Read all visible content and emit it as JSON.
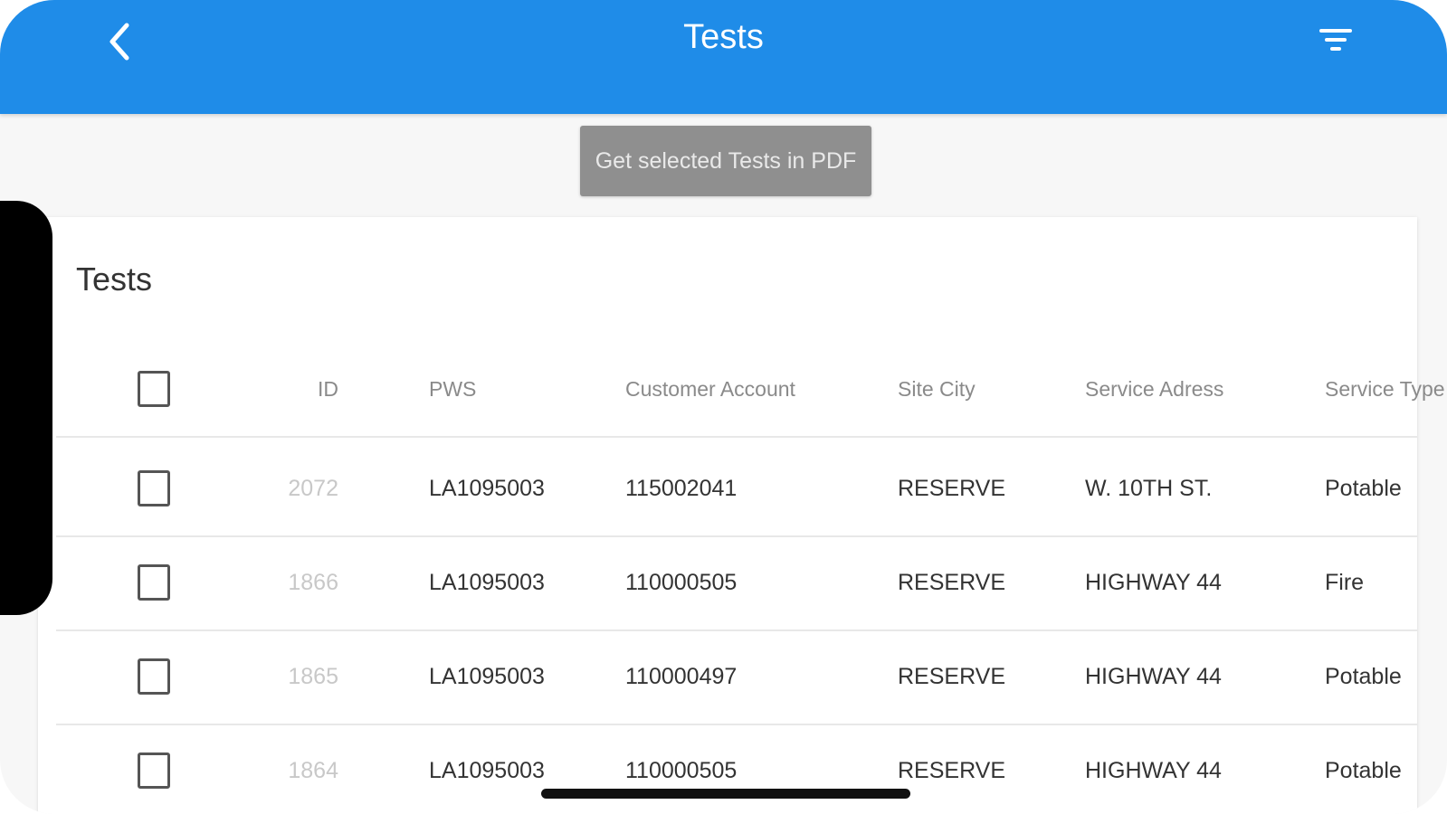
{
  "header": {
    "title": "Tests",
    "back_icon": "chevron-left-icon",
    "filter_icon": "filter-icon",
    "bar_color": "#1f8ce8"
  },
  "actions": {
    "pdf_button_label": "Get selected Tests in PDF"
  },
  "card": {
    "title": "Tests"
  },
  "table": {
    "columns": {
      "id": "ID",
      "pws": "PWS",
      "customer_account": "Customer Account",
      "site_city": "Site City",
      "service_address": "Service Adress",
      "service_type": "Service Type"
    },
    "rows": [
      {
        "id": "2072",
        "pws": "LA1095003",
        "customer_account": "115002041",
        "site_city": "RESERVE",
        "service_address": "W. 10TH ST.",
        "service_type": "Potable"
      },
      {
        "id": "1866",
        "pws": "LA1095003",
        "customer_account": "110000505",
        "site_city": "RESERVE",
        "service_address": "HIGHWAY 44",
        "service_type": "Fire"
      },
      {
        "id": "1865",
        "pws": "LA1095003",
        "customer_account": "110000497",
        "site_city": "RESERVE",
        "service_address": "HIGHWAY 44",
        "service_type": "Potable"
      },
      {
        "id": "1864",
        "pws": "LA1095003",
        "customer_account": "110000505",
        "site_city": "RESERVE",
        "service_address": "HIGHWAY 44",
        "service_type": "Potable"
      }
    ]
  }
}
